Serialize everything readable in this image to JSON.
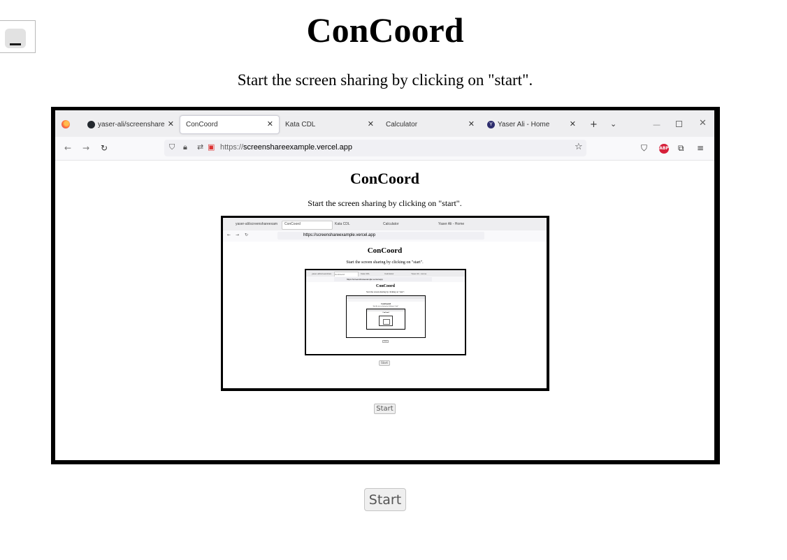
{
  "page": {
    "title": "ConCoord",
    "instruction": "Start the screen sharing by clicking on \"start\".",
    "start_label": "Start"
  },
  "menu": {
    "icon": "hamburger-icon"
  },
  "shared_screen": {
    "browser": {
      "tabs": [
        {
          "label": "yaser-ali/screenshareexam",
          "icon": "github-icon",
          "active": false
        },
        {
          "label": "ConCoord",
          "active": true
        },
        {
          "label": "Kata CDL",
          "active": false
        },
        {
          "label": "Calculator",
          "active": false
        },
        {
          "label": "Yaser Ali - Home",
          "icon": "yaser-icon",
          "active": false
        }
      ],
      "url_protocol": "https://",
      "url_host": "screenshareexample.vercel.app",
      "abp_label": "ABP"
    },
    "page": {
      "title": "ConCoord",
      "instruction": "Start the screen sharing by clicking on \"start\".",
      "start_label": "Start"
    }
  },
  "nested_screen": {
    "tabs": [
      {
        "label": "yaser-ali/screenshareexam",
        "active": false
      },
      {
        "label": "ConCoord",
        "active": true
      },
      {
        "label": "Kata CDL",
        "active": false
      },
      {
        "label": "Calculator",
        "active": false
      },
      {
        "label": "Yaser Ali - Home",
        "active": false
      }
    ],
    "url": "https://screenshareexample.vercel.app",
    "title": "ConCoord",
    "instruction": "Start the screen sharing by clicking on \"start\".",
    "start_label": "Start"
  },
  "deep_screen": {
    "tabs": [
      "yaser-ali/screenshareexam",
      "ConCoord",
      "Kata CDL",
      "Calculator",
      "Yaser Ali - Home"
    ],
    "url": "https://screenshareexample.vercel.app",
    "title": "ConCoord",
    "instruction": "Start the screen sharing by clicking on \"start\".",
    "start_label": "Start"
  },
  "deeper_screen": {
    "title": "ConCoord",
    "instruction": "Start the screen sharing by clicking on \"start\"."
  },
  "deepest_screen": {
    "title": "ConCoord"
  }
}
